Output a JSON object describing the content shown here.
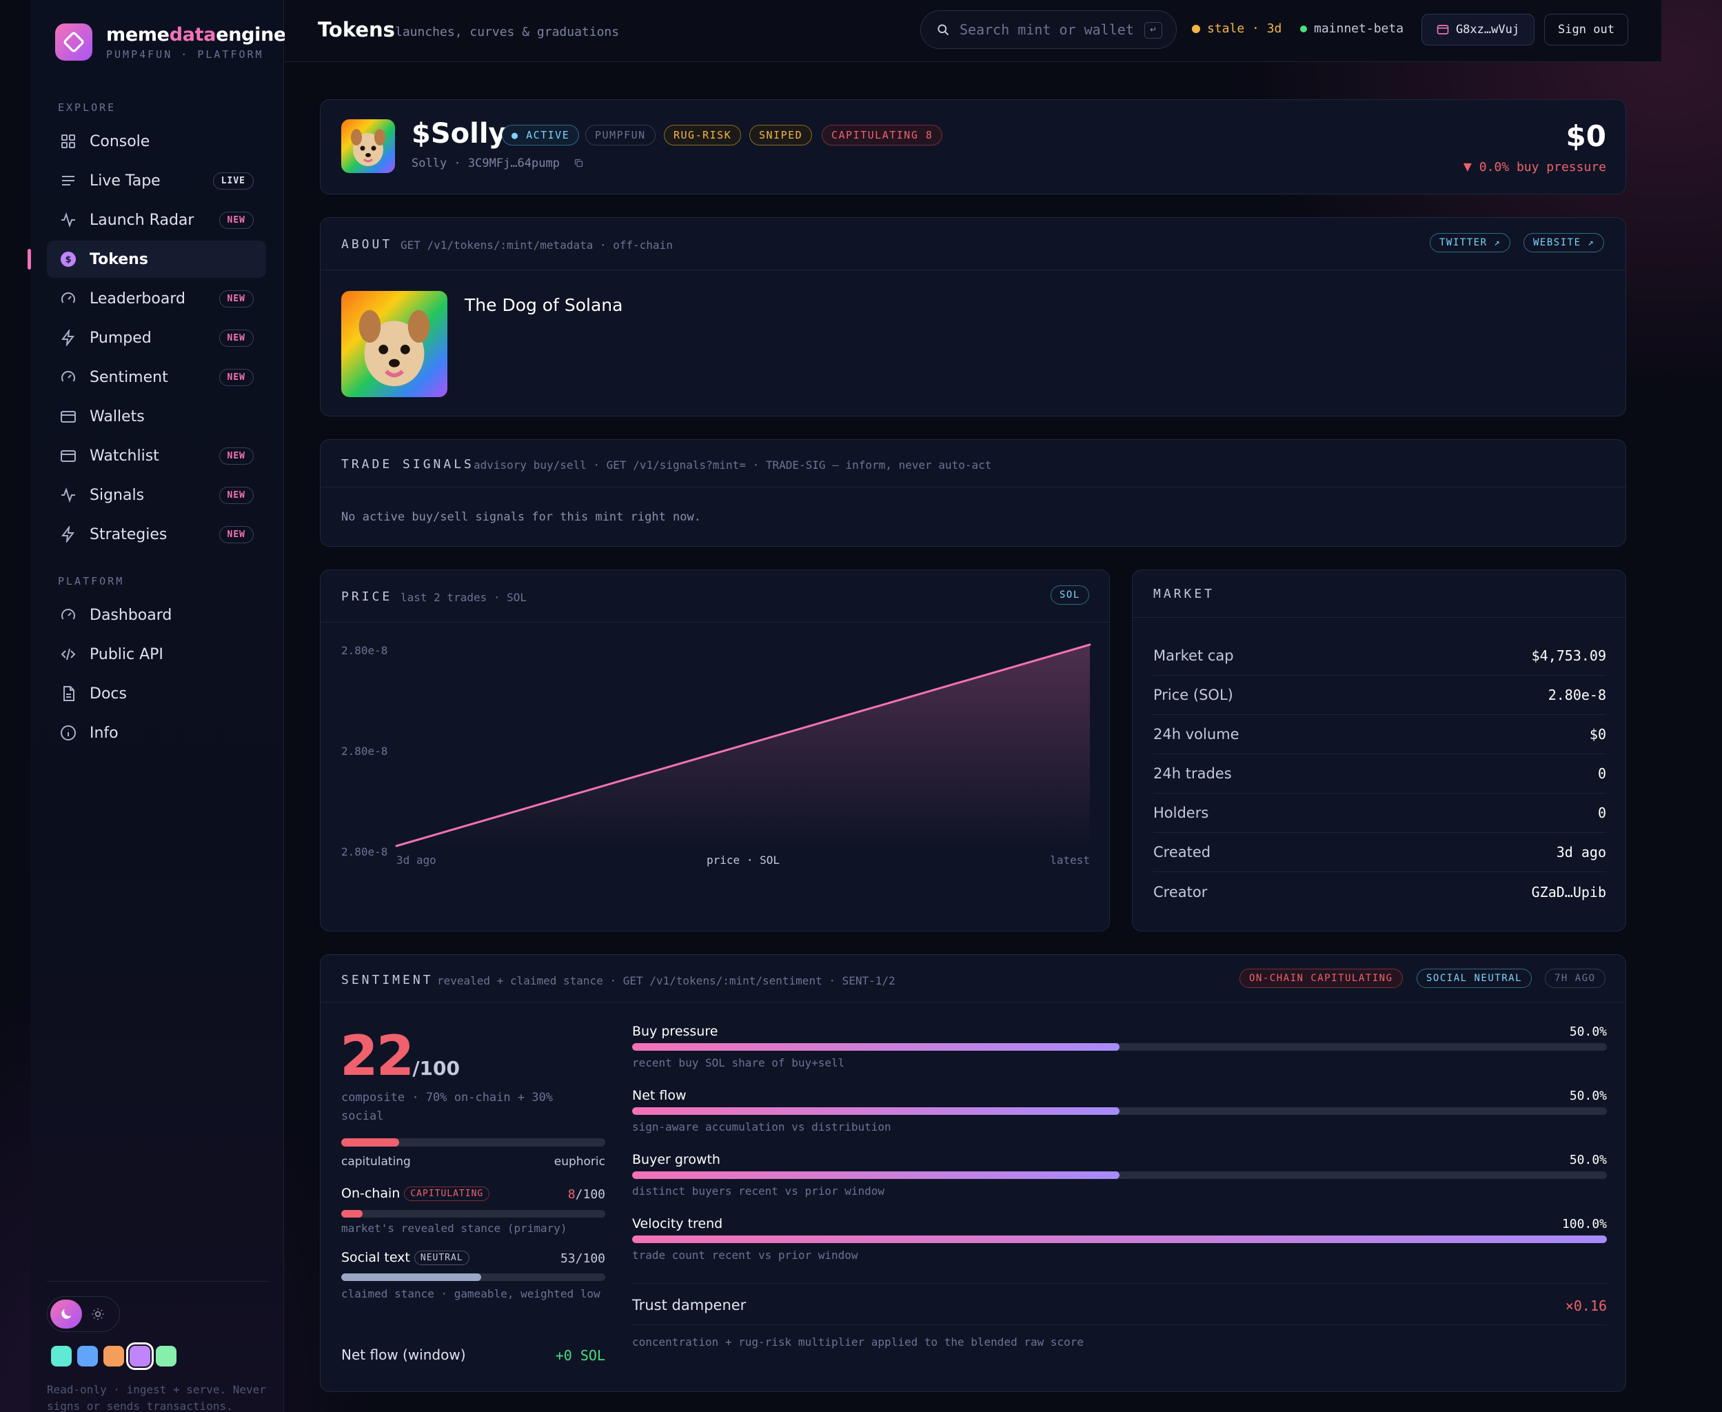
{
  "brand": {
    "name_pre": "meme",
    "name_acc": "data",
    "name_post": "engine",
    "subtitle": "PUMP4FUN · PLATFORM"
  },
  "sidebar": {
    "explore_label": "EXPLORE",
    "platform_label": "PLATFORM",
    "explore_items": [
      {
        "label": "Console",
        "badge": "",
        "icon": "grid-icon"
      },
      {
        "label": "Live Tape",
        "badge": "LIVE",
        "icon": "list-icon"
      },
      {
        "label": "Launch Radar",
        "badge": "NEW",
        "icon": "pulse-icon"
      },
      {
        "label": "Tokens",
        "badge": "",
        "icon": "coin-icon",
        "active": true
      },
      {
        "label": "Leaderboard",
        "badge": "NEW",
        "icon": "gauge-icon"
      },
      {
        "label": "Pumped",
        "badge": "NEW",
        "icon": "bolt-icon"
      },
      {
        "label": "Sentiment",
        "badge": "NEW",
        "icon": "gauge-icon"
      },
      {
        "label": "Wallets",
        "badge": "",
        "icon": "wallet-icon"
      },
      {
        "label": "Watchlist",
        "badge": "NEW",
        "icon": "wallet-icon"
      },
      {
        "label": "Signals",
        "badge": "NEW",
        "icon": "pulse-icon"
      },
      {
        "label": "Strategies",
        "badge": "NEW",
        "icon": "bolt-icon"
      }
    ],
    "platform_items": [
      {
        "label": "Dashboard",
        "icon": "gauge-icon"
      },
      {
        "label": "Public API",
        "icon": "code-icon"
      },
      {
        "label": "Docs",
        "icon": "doc-icon"
      },
      {
        "label": "Info",
        "icon": "info-icon"
      }
    ],
    "swatches": [
      "#5eead4",
      "#60a5fa",
      "#f59e5b",
      "#c084fc",
      "#86efac"
    ],
    "footer": "Read-only · ingest + serve. Never signs or sends transactions."
  },
  "topbar": {
    "title": "Tokens",
    "subtitle": "launches, curves & graduations",
    "search_placeholder": "Search mint or wallet",
    "kbd": "↵",
    "stale_status": "stale · 3d",
    "network": "mainnet-beta",
    "wallet": "G8xz…wVuj",
    "signout": "Sign out"
  },
  "token": {
    "symbol": "$Solly",
    "name": "Solly",
    "mint": "3C9MFj…64pump",
    "tags": {
      "active": "ACTIVE",
      "pumpfun": "PUMPFUN",
      "rugrisk": "RUG-RISK",
      "sniped": "SNIPED",
      "capitulating": "CAPITULATING 8"
    },
    "price": "$0",
    "pressure": "0.0% buy pressure"
  },
  "about": {
    "title": "ABOUT",
    "endpoint": "GET /v1/tokens/:mint/metadata · off-chain",
    "twitter": "TWITTER ↗",
    "website": "WEBSITE ↗",
    "description": "The Dog of Solana"
  },
  "signals": {
    "title": "TRADE SIGNALS",
    "endpoint": "advisory buy/sell · GET /v1/signals?mint= · TRADE-SIG — inform, never auto-act",
    "empty": "No active buy/sell signals for this mint right now."
  },
  "price_chart": {
    "title": "PRICE",
    "subtitle": "last 2 trades · SOL",
    "unit_tag": "SOL",
    "x_left": "3d ago",
    "x_mid": "price · SOL",
    "x_right": "latest",
    "line_color": "#f472b6"
  },
  "chart_data": {
    "type": "area",
    "y_ticks": [
      "2.80e-8",
      "2.80e-8",
      "2.80e-8"
    ],
    "x_labels": [
      "3d ago",
      "latest"
    ],
    "xlabel": "price · SOL",
    "series": [
      {
        "values": [
          2.8e-08,
          2.8e-08
        ]
      }
    ]
  },
  "market": {
    "title": "MARKET",
    "rows": [
      {
        "label": "Market cap",
        "value": "$4,753.09"
      },
      {
        "label": "Price (SOL)",
        "value": "2.80e-8"
      },
      {
        "label": "24h volume",
        "value": "$0"
      },
      {
        "label": "24h trades",
        "value": "0"
      },
      {
        "label": "Holders",
        "value": "0"
      },
      {
        "label": "Created",
        "value": "3d ago"
      },
      {
        "label": "Creator",
        "value": "GZaD…Upib"
      }
    ]
  },
  "sentiment": {
    "title": "SENTIMENT",
    "endpoint": "revealed + claimed stance · GET /v1/tokens/:mint/sentiment · SENT-1/2",
    "tag_onchain": "ON-CHAIN CAPITULATING",
    "tag_social": "SOCIAL NEUTRAL",
    "tag_age": "7H AGO",
    "score": "22",
    "score_max": "/100",
    "score_fraction": 0.22,
    "composite": "composite · 70% on-chain + 30% social",
    "scale_low": "capitulating",
    "scale_high": "euphoric",
    "onchain_label": "On-chain",
    "onchain_tag": "CAPITULATING",
    "onchain_score": "8",
    "onchain_max": "/100",
    "onchain_fraction": 0.08,
    "onchain_hint": "market's revealed stance (primary)",
    "social_label": "Social text",
    "social_tag": "NEUTRAL",
    "social_value": "53/100",
    "social_fraction": 0.53,
    "social_hint": "claimed stance · gameable, weighted low",
    "netflow_label": "Net flow (window)",
    "netflow_value": "+0 SOL",
    "metrics": [
      {
        "label": "Buy pressure",
        "value": "50.0%",
        "fraction": 0.5,
        "hint": "recent buy SOL share of buy+sell"
      },
      {
        "label": "Net flow",
        "value": "50.0%",
        "fraction": 0.5,
        "hint": "sign-aware accumulation vs distribution"
      },
      {
        "label": "Buyer growth",
        "value": "50.0%",
        "fraction": 0.5,
        "hint": "distinct buyers recent vs prior window"
      },
      {
        "label": "Velocity trend",
        "value": "100.0%",
        "fraction": 1.0,
        "hint": "trade count recent vs prior window"
      }
    ],
    "trust_label": "Trust dampener",
    "trust_value": "×0.16",
    "trust_hint": "concentration + rug-risk multiplier applied to the blended raw score"
  }
}
